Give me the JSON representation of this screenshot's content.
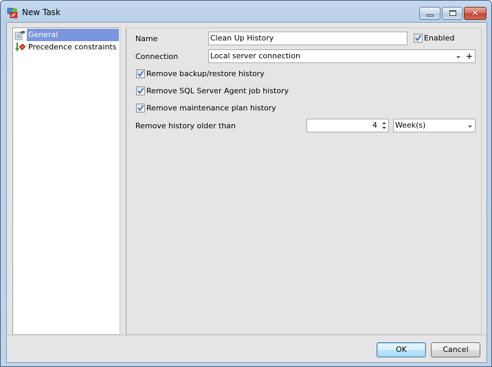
{
  "window": {
    "title": "New Task",
    "controls": [
      "minimize",
      "maximize",
      "close"
    ]
  },
  "tree": {
    "items": [
      {
        "label": "General",
        "icon": "general-settings-icon",
        "selected": true
      },
      {
        "label": "Precedence constraints",
        "icon": "precedence-constraint-icon",
        "selected": false
      }
    ]
  },
  "form": {
    "name_label": "Name",
    "name_value": "Clean Up History",
    "enabled_label": "Enabled",
    "enabled_checked": true,
    "connection_label": "Connection",
    "connection_value": "Local server connection",
    "checkboxes": [
      {
        "label": "Remove backup/restore history",
        "checked": true
      },
      {
        "label": "Remove SQL Server Agent job history",
        "checked": true
      },
      {
        "label": "Remove maintenance plan history",
        "checked": true
      }
    ],
    "older_than_label": "Remove history older than",
    "older_than_value": "4",
    "older_than_unit": "Week(s)"
  },
  "buttons": {
    "ok": "OK",
    "cancel": "Cancel"
  },
  "colors": {
    "selection": "#7b96de",
    "check": "#2a6fd0"
  }
}
